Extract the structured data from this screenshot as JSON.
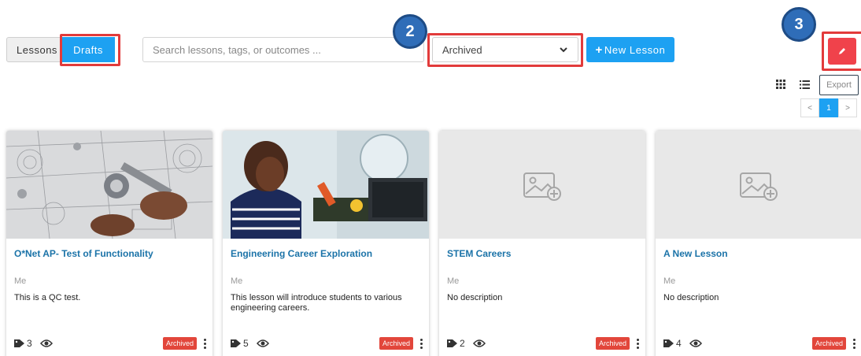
{
  "toolbar": {
    "tabs": [
      {
        "label": "Lessons"
      },
      {
        "label": "Drafts"
      }
    ],
    "search_placeholder": "Search lessons, tags, or outcomes ...",
    "filter_value": "Archived",
    "new_lesson_label": "New Lesson",
    "callout_2": "2",
    "callout_3": "3"
  },
  "view": {
    "export_label": "Export",
    "pager": {
      "prev": "<",
      "current": "1",
      "next": ">"
    }
  },
  "cards": [
    {
      "title": "O*Net AP- Test of Functionality",
      "author": "Me",
      "description": "This is a QC test.",
      "tags": "3",
      "status": "Archived"
    },
    {
      "title": "Engineering Career Exploration",
      "author": "Me",
      "description": "This lesson will introduce students to various engineering careers.",
      "tags": "5",
      "status": "Archived"
    },
    {
      "title": "STEM Careers",
      "author": "Me",
      "description": "No description",
      "tags": "2",
      "status": "Archived"
    },
    {
      "title": "A New Lesson",
      "author": "Me",
      "description": "No description",
      "tags": "4",
      "status": "Archived"
    }
  ],
  "colors": {
    "accent": "#1da1f2",
    "danger": "#f0424b",
    "highlight": "#e23b3b",
    "callout": "#2f6db8",
    "link": "#1b73a8"
  },
  "icons": [
    "chevron-down-icon",
    "pencil-icon",
    "grid-icon",
    "list-icon",
    "tag-icon",
    "eye-icon",
    "image-placeholder-icon",
    "kebab-icon"
  ]
}
